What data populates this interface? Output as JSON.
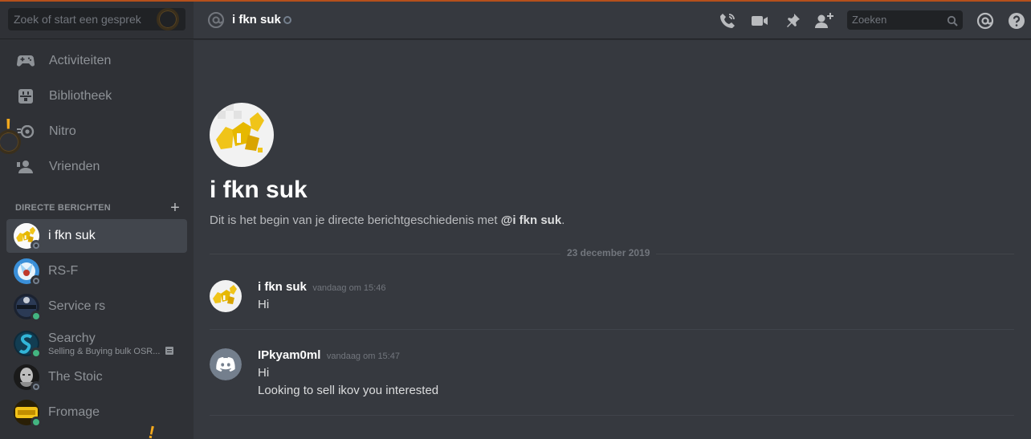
{
  "sidebar": {
    "search_placeholder": "Zoek of start een gesprek",
    "nav": [
      {
        "label": "Activiteiten",
        "icon": "controller-icon"
      },
      {
        "label": "Bibliotheek",
        "icon": "library-icon"
      },
      {
        "label": "Nitro",
        "icon": "nitro-icon"
      },
      {
        "label": "Vrienden",
        "icon": "friends-icon"
      }
    ],
    "dm_header": "DIRECTE BERICHTEN",
    "dm_add": "+",
    "dms": [
      {
        "name": "i fkn suk",
        "status": "offline",
        "active": true
      },
      {
        "name": "RS-F",
        "status": "offline"
      },
      {
        "name": "Service rs",
        "status": "online"
      },
      {
        "name": "Searchy",
        "status": "online",
        "subtext": "Selling & Buying bulk OSR..."
      },
      {
        "name": "The Stoic",
        "status": "offline"
      },
      {
        "name": "Fromage",
        "status": "online"
      }
    ]
  },
  "topbar": {
    "channel_name": "i fkn suk",
    "search_placeholder": "Zoeken",
    "icons": [
      "start-voice-call-icon",
      "start-video-call-icon",
      "pinned-messages-icon",
      "add-friend-icon",
      "search-icon",
      "mentions-icon",
      "help-icon"
    ]
  },
  "chat": {
    "intro_name": "i fkn suk",
    "intro_text": "Dit is het begin van je directe berichtgeschiedenis met",
    "intro_mention": "@i fkn suk",
    "intro_period": ".",
    "date_divider": "23 december 2019",
    "messages": [
      {
        "author": "i fkn suk",
        "time": "vandaag om 15:46",
        "lines": [
          "Hi"
        ]
      },
      {
        "author": "IPkyam0ml",
        "time": "vandaag om 15:47",
        "lines": [
          "Hi",
          "Looking to sell ikov you interested"
        ]
      }
    ]
  },
  "colors": {
    "background": "#36393f",
    "sidebar": "#2f3136",
    "online": "#43b581",
    "offline": "#747f8d",
    "discord_blurple": "#747f8d",
    "accent_line": "#b5501b"
  }
}
